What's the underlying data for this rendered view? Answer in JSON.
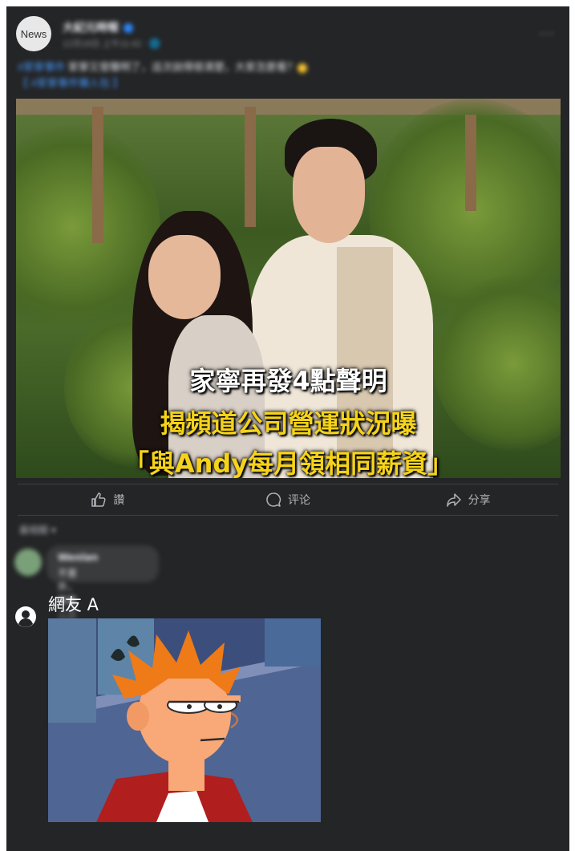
{
  "post": {
    "page_avatar_text": "News",
    "page_name": "大紀元時報",
    "timestamp": "12月18日 上午11:42 · 🌐",
    "more": "···",
    "caption_tag": "#家寧事件",
    "caption_text": " 家寧又發聲明了，這次說得很清楚，大家怎麼看？",
    "caption_link": "【 #家寧事件懶人包 】"
  },
  "headline": {
    "line1": "家寧再發4點聲明",
    "line2": "揭頻道公司營運狀況曝",
    "line3": "「與Andy每月領相同薪資」"
  },
  "actions": {
    "like": "讚",
    "comment": "评论",
    "share": "分享"
  },
  "comments": {
    "sort_label": "最相關 ▾",
    "first": {
      "author": "Wenlan",
      "text": "不意外，常看二三"
    },
    "second": {
      "author": "網友 A"
    }
  },
  "colors": {
    "background": "#242526",
    "headline_white": "#ffffff",
    "headline_yellow": "#f5d31a",
    "muted": "#b0b3b8"
  }
}
